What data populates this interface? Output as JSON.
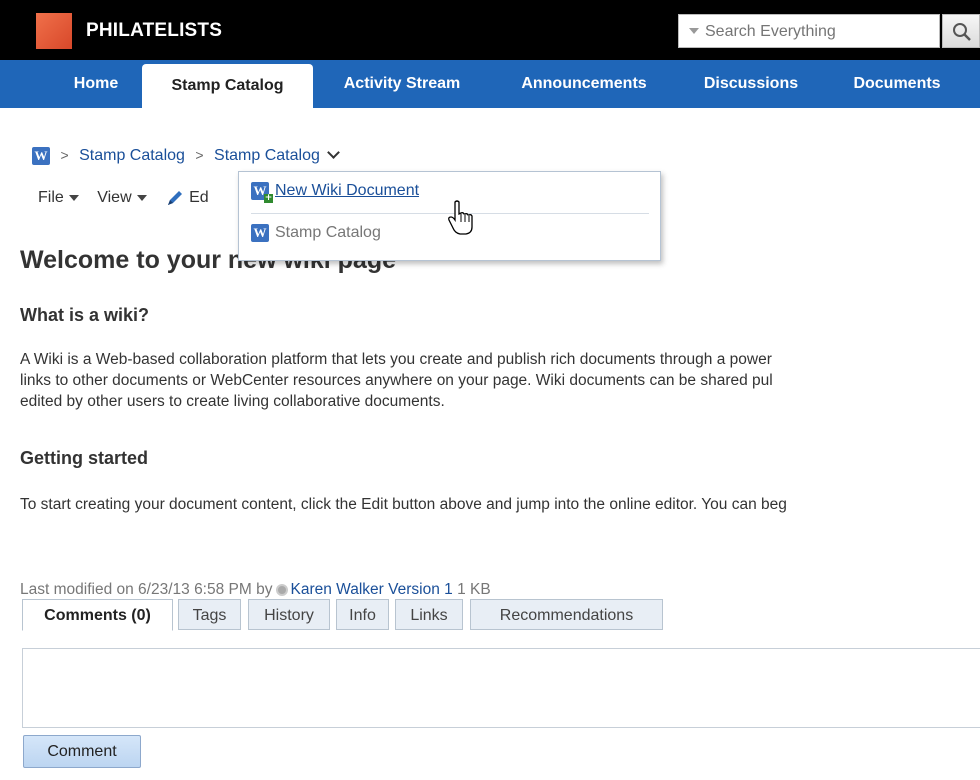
{
  "header": {
    "app_title": "PHILATELISTS",
    "search_placeholder": "Search Everything"
  },
  "nav": {
    "tabs": [
      {
        "label": "Home"
      },
      {
        "label": "Stamp Catalog",
        "active": true
      },
      {
        "label": "Activity Stream"
      },
      {
        "label": "Announcements"
      },
      {
        "label": "Discussions"
      },
      {
        "label": "Documents"
      }
    ]
  },
  "breadcrumb": {
    "sep": ">",
    "items": [
      "Stamp Catalog",
      "Stamp Catalog"
    ]
  },
  "toolbar": {
    "file": "File",
    "view": "View",
    "edit": "Ed"
  },
  "dropdown": {
    "items": [
      {
        "label": "New Wiki Document",
        "icon": "wiki-add-icon"
      },
      {
        "label": "Stamp Catalog",
        "icon": "wiki-icon"
      }
    ]
  },
  "page": {
    "title": "Welcome to your new wiki page",
    "sections": [
      {
        "heading": "What is a wiki?",
        "lines": [
          "A Wiki is a Web-based collaboration platform that lets you create and publish rich documents through a power",
          "links to other documents or WebCenter resources anywhere on your page. Wiki documents can be shared pul",
          "edited by other users to create living collaborative documents."
        ]
      },
      {
        "heading": "Getting started",
        "lines": [
          "To start creating your document content, click the Edit button above and jump into the online editor. You can beg"
        ]
      }
    ]
  },
  "meta": {
    "modified": "Last modified on 6/23/13 6:58 PM",
    "by": "by",
    "author": "Karen Walker",
    "version": "Version 1",
    "size": "1 KB"
  },
  "tabs": [
    {
      "label": "Comments (0)",
      "active": true
    },
    {
      "label": "Tags"
    },
    {
      "label": "History"
    },
    {
      "label": "Info"
    },
    {
      "label": "Links"
    },
    {
      "label": "Recommendations"
    }
  ],
  "comment_button": "Comment",
  "wiki_icon_letter": "W",
  "colors": {
    "nav": "#1f66b8",
    "header": "#000000",
    "link": "#1a4f99"
  }
}
